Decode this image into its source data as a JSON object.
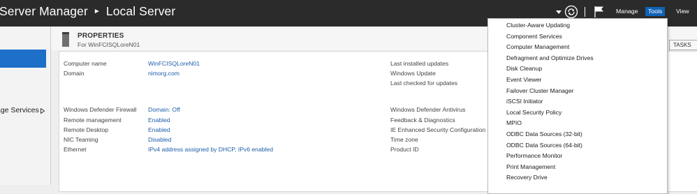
{
  "titlebar": {
    "app": "Server Manager",
    "page": "Local Server",
    "menu": {
      "manage": "Manage",
      "tools": "Tools",
      "view": "View"
    }
  },
  "nav": {
    "item_label": "age Services"
  },
  "properties": {
    "title": "PROPERTIES",
    "subtitle": "For WinFCISQLoreN01",
    "tasks": "TASKS",
    "left": [
      {
        "label": "Computer name",
        "value": "WinFCISQLoreN01"
      },
      {
        "label": "Domain",
        "value": "nimorg.com"
      },
      {
        "label": "Windows Defender Firewall",
        "value": "Domain: Off"
      },
      {
        "label": "Remote management",
        "value": "Enabled"
      },
      {
        "label": "Remote Desktop",
        "value": "Enabled"
      },
      {
        "label": "NIC Teaming",
        "value": "Disabled"
      },
      {
        "label": "Ethernet",
        "value": "IPv4 address assigned by DHCP, IPv6 enabled"
      }
    ],
    "right": [
      "Last installed updates",
      "Windows Update",
      "Last checked for updates",
      "Windows Defender Antivirus",
      "Feedback & Diagnostics",
      "IE Enhanced Security Configuration",
      "Time zone",
      "Product ID"
    ]
  },
  "tools_menu": [
    "Cluster-Aware Updating",
    "Component Services",
    "Computer Management",
    "Defragment and Optimize Drives",
    "Disk Cleanup",
    "Event Viewer",
    "Failover Cluster Manager",
    "iSCSI Initiator",
    "Local Security Policy",
    "MPIO",
    "ODBC Data Sources (32-bit)",
    "ODBC Data Sources (64-bit)",
    "Performance Monitor",
    "Print Management",
    "Recovery Drive"
  ],
  "colors": {
    "accent": "#0f63b7",
    "link": "#1e5ea8",
    "titlebar": "#2b2b2b"
  }
}
